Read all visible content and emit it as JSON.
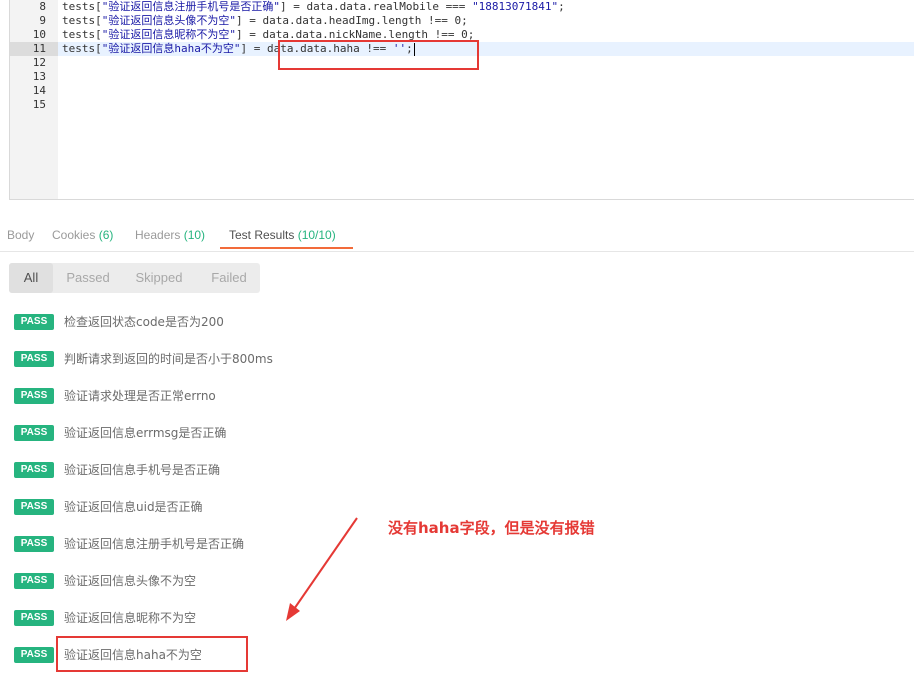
{
  "editor": {
    "lines": [
      {
        "num": "8",
        "pre": "tests[",
        "str": "\"验证返回信息注册手机号是否正确\"",
        "post": "] = data.data.realMobile === ",
        "str2": "\"18813071841\"",
        "tail": ";"
      },
      {
        "num": "9",
        "pre": "tests[",
        "str": "\"验证返回信息头像不为空\"",
        "post": "] = data.data.headImg.length !== 0;",
        "str2": "",
        "tail": ""
      },
      {
        "num": "10",
        "pre": "tests[",
        "str": "\"验证返回信息昵称不为空\"",
        "post": "] = data.data.nickName.length !== 0;",
        "str2": "",
        "tail": ""
      },
      {
        "num": "11",
        "pre": "tests[",
        "str": "\"验证返回信息haha不为空\"",
        "post": "] = data.data.haha !== ",
        "str2": "''",
        "tail": ";"
      },
      {
        "num": "12",
        "pre": "",
        "str": "",
        "post": "",
        "str2": "",
        "tail": ""
      },
      {
        "num": "13",
        "pre": "",
        "str": "",
        "post": "",
        "str2": "",
        "tail": ""
      },
      {
        "num": "14",
        "pre": "",
        "str": "",
        "post": "",
        "str2": "",
        "tail": ""
      },
      {
        "num": "15",
        "pre": "",
        "str": "",
        "post": "",
        "str2": "",
        "tail": ""
      }
    ]
  },
  "tabs": [
    {
      "label": "Body",
      "count": ""
    },
    {
      "label": "Cookies",
      "count": "(6)"
    },
    {
      "label": "Headers",
      "count": "(10)"
    },
    {
      "label": "Test Results",
      "count": "(10/10)"
    }
  ],
  "filters": [
    "All",
    "Passed",
    "Skipped",
    "Failed"
  ],
  "badge_label": "PASS",
  "results": [
    "检查返回状态code是否为200",
    "判断请求到返回的时间是否小于800ms",
    "验证请求处理是否正常errno",
    "验证返回信息errmsg是否正确",
    "验证返回信息手机号是否正确",
    "验证返回信息uid是否正确",
    "验证返回信息注册手机号是否正确",
    "验证返回信息头像不为空",
    "验证返回信息昵称不为空",
    "验证返回信息haha不为空"
  ],
  "annotation": "没有haha字段，但是没有报错",
  "colors": {
    "pass": "#26b47f",
    "annotation": "#e53935",
    "active_tab_underline": "#f26b3a"
  }
}
